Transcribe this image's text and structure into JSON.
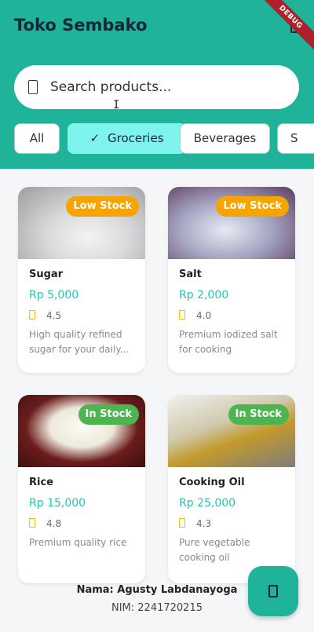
{
  "app": {
    "title": "Toko Sembako",
    "debug_label": "DEBUG"
  },
  "search": {
    "placeholder": "Search products..."
  },
  "categories": [
    {
      "label": "All",
      "selected": false
    },
    {
      "label": "Groceries",
      "selected": true
    },
    {
      "label": "Beverages",
      "selected": false
    },
    {
      "label": "S",
      "selected": false
    }
  ],
  "products": [
    {
      "name": "Sugar",
      "price": "Rp 5,000",
      "rating": "4.5",
      "description": "High quality refined sugar for your daily...",
      "stock": "Low Stock"
    },
    {
      "name": "Salt",
      "price": "Rp 2,000",
      "rating": "4.0",
      "description": "Premium iodized salt for cooking",
      "stock": "Low Stock"
    },
    {
      "name": "Rice",
      "price": "Rp 15,000",
      "rating": "4.8",
      "description": "Premium quality rice",
      "stock": "In Stock"
    },
    {
      "name": "Cooking Oil",
      "price": "Rp 25,000",
      "rating": "4.3",
      "description": "Pure vegetable cooking oil",
      "stock": "In Stock"
    }
  ],
  "footer": {
    "name": "Nama: Agusty Labdanayoga",
    "nim": "NIM: 2241720215"
  },
  "icons": {
    "search": "search-icon",
    "star": "star-icon",
    "fab": "cart-icon",
    "header": "settings-icon"
  },
  "colors": {
    "primary": "#1fb39a",
    "chip_selected": "#7ff4ee",
    "price": "#20c7b4",
    "low_stock": "#f7a400",
    "in_stock": "#4cb54f"
  }
}
